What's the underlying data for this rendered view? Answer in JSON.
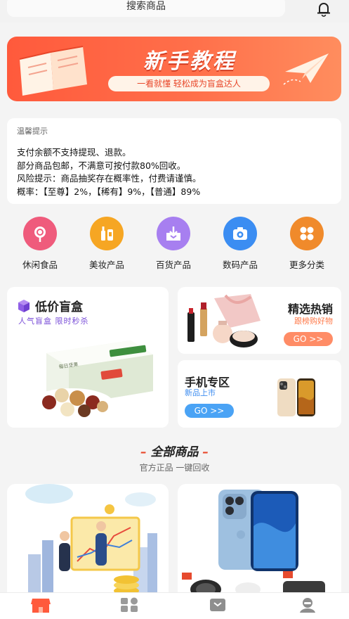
{
  "search": {
    "placeholder": "搜索商品"
  },
  "banner": {
    "title": "新手教程",
    "subtitle": "一看就懂  轻松成为盲盒达人"
  },
  "notice": {
    "heading": "温馨提示",
    "lines": [
      "支付余额不支持提现、退款。",
      "部分商品包邮，不满意可按付款80%回收。",
      "风险提示：商品抽奖存在概率性，付费请谨慎。",
      "概率：【至尊】2%，【稀有】9%，【普通】89%"
    ]
  },
  "categories": [
    {
      "label": "休闲食品",
      "icon": "lollipop-icon",
      "color": "#ef5b7c"
    },
    {
      "label": "美妆产品",
      "icon": "cosmetics-icon",
      "color": "#f6a623"
    },
    {
      "label": "百货产品",
      "icon": "shopping-box-icon",
      "color": "#a77ff0"
    },
    {
      "label": "数码产品",
      "icon": "camera-icon",
      "color": "#3b8df2"
    },
    {
      "label": "更多分类",
      "icon": "grid-icon",
      "color": "#f08a2b"
    }
  ],
  "promos": {
    "blind_box": {
      "title": "低价盲盒",
      "subtitle": "人气盲盒  限时秒杀",
      "box_label": "每日坚果"
    },
    "hot": {
      "title": "精选热销",
      "subtitle": "跟榜购好物",
      "go": "GO >>"
    },
    "phone": {
      "title": "手机专区",
      "subtitle": "新品上市",
      "go": "GO >>"
    }
  },
  "section": {
    "title": "全部商品",
    "subtitle": "官方正品 一键回收"
  },
  "colors": {
    "accent": "#ff5a3c",
    "tab_active": "#ff5a3c",
    "tab_inactive": "#9a9a9a"
  }
}
